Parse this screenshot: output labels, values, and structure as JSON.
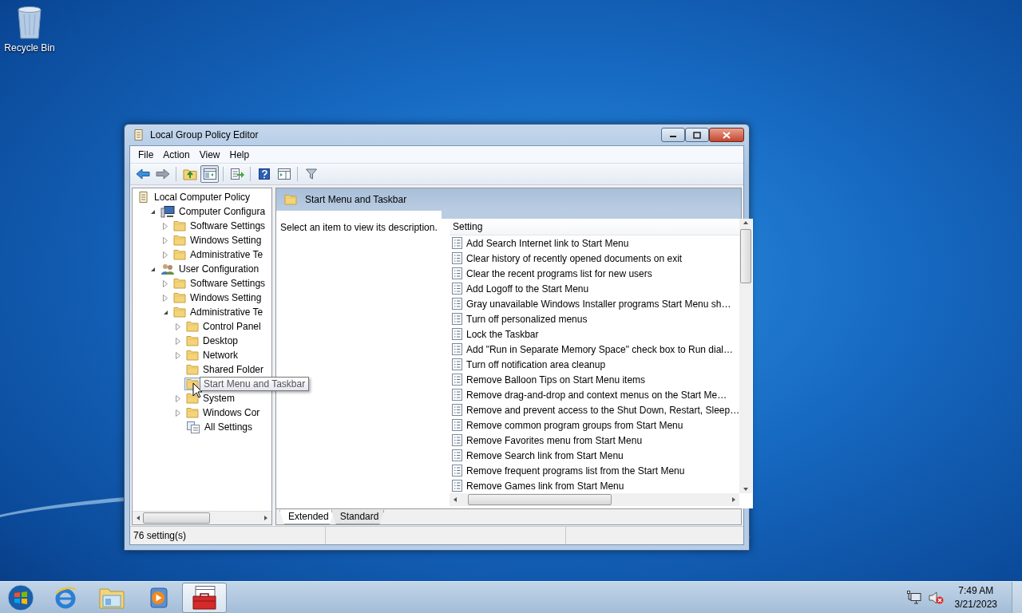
{
  "desktop_icons": [
    {
      "label": "Recycle Bin"
    }
  ],
  "window": {
    "title": "Local Group Policy Editor",
    "menu": [
      "File",
      "Action",
      "View",
      "Help"
    ],
    "toolbar": [
      {
        "kind": "back",
        "pressed": false
      },
      {
        "kind": "forward",
        "pressed": false
      },
      {
        "kind": "up",
        "pressed": false
      },
      {
        "kind": "tree",
        "pressed": true
      },
      {
        "kind": "export",
        "pressed": false
      },
      {
        "kind": "help",
        "pressed": false
      },
      {
        "kind": "pane",
        "pressed": false
      },
      {
        "kind": "filter",
        "pressed": false
      }
    ],
    "tree": [
      {
        "label": "Local Computer Policy",
        "kind": "policy",
        "selected": false,
        "children": [
          {
            "label": "Computer Configura",
            "kind": "computer",
            "expanded": true,
            "selected": false,
            "children": [
              {
                "label": "Software Settings",
                "kind": "folder",
                "expanded": false,
                "selected": false
              },
              {
                "label": "Windows Setting",
                "kind": "folder",
                "expanded": false,
                "selected": false
              },
              {
                "label": "Administrative Te",
                "kind": "folder",
                "expanded": false,
                "selected": false
              }
            ]
          },
          {
            "label": "User Configuration",
            "kind": "user",
            "expanded": true,
            "selected": false,
            "children": [
              {
                "label": "Software Settings",
                "kind": "folder",
                "expanded": false,
                "selected": false
              },
              {
                "label": "Windows Setting",
                "kind": "folder",
                "expanded": false,
                "selected": false
              },
              {
                "label": "Administrative Te",
                "kind": "folder",
                "expanded": true,
                "selected": false,
                "children": [
                  {
                    "label": "Control Panel",
                    "kind": "folder",
                    "expanded": false,
                    "selected": false
                  },
                  {
                    "label": "Desktop",
                    "kind": "folder",
                    "expanded": false,
                    "selected": false
                  },
                  {
                    "label": "Network",
                    "kind": "folder",
                    "expanded": false,
                    "selected": false
                  },
                  {
                    "label": "Shared Folder",
                    "kind": "folder",
                    "selected": false
                  },
                  {
                    "kind": "folder",
                    "selected": true
                  },
                  {
                    "label": "System",
                    "kind": "folder",
                    "expanded": false,
                    "selected": false
                  },
                  {
                    "label": "Windows Cor",
                    "kind": "folder",
                    "expanded": false,
                    "selected": false
                  },
                  {
                    "label": "All Settings",
                    "kind": "settings",
                    "selected": false
                  }
                ]
              }
            ]
          }
        ]
      }
    ],
    "tooltip": "Start Menu and Taskbar",
    "header_title": "Start Menu and Taskbar",
    "description": "Select an item to view its description.",
    "column_header": "Setting",
    "settings": [
      "Add Search Internet link to Start Menu",
      "Clear history of recently opened documents on exit",
      "Clear the recent programs list for new users",
      "Add Logoff to the Start Menu",
      "Gray unavailable Windows Installer programs Start Menu sh…",
      "Turn off personalized menus",
      "Lock the Taskbar",
      "Add \"Run in Separate Memory Space\" check box to Run dial…",
      "Turn off notification area cleanup",
      "Remove Balloon Tips on Start Menu items",
      "Remove drag-and-drop and context menus on the Start Me…",
      "Remove and prevent access to the Shut Down, Restart, Sleep…",
      "Remove common program groups from Start Menu",
      "Remove Favorites menu from Start Menu",
      "Remove Search link from Start Menu",
      "Remove frequent programs list from the Start Menu",
      "Remove Games link from Start Menu"
    ],
    "tabs": [
      {
        "label": "Extended",
        "selected": true
      },
      {
        "label": "Standard",
        "selected": false
      }
    ],
    "status": "76 setting(s)"
  },
  "taskbar": {
    "items": [
      {
        "kind": "start",
        "active": false
      },
      {
        "kind": "browser",
        "active": false
      },
      {
        "kind": "explorer",
        "active": false
      },
      {
        "kind": "media",
        "active": false
      },
      {
        "kind": "toolbox",
        "active": true
      }
    ],
    "tray": [
      {
        "kind": "network"
      },
      {
        "kind": "volume-muted"
      }
    ],
    "time": "7:49 AM",
    "date": "3/21/2023"
  }
}
